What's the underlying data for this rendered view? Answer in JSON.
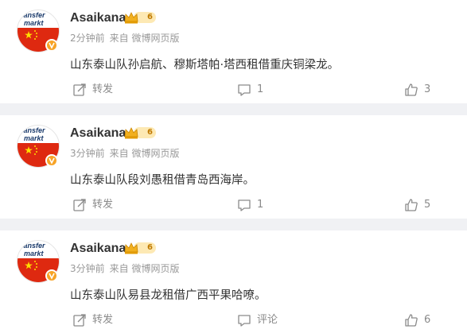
{
  "avatar": {
    "logo_line1": "ransfer",
    "logo_line2": "markt"
  },
  "posts": [
    {
      "user": "Asaikana",
      "rank": "6",
      "time": "2分钟前",
      "source": "来自 微博网页版",
      "text": "山东泰山队孙启航、穆斯塔帕·塔西租借重庆铜梁龙。",
      "share": "转发",
      "comment": "1",
      "like": "3"
    },
    {
      "user": "Asaikana",
      "rank": "6",
      "time": "3分钟前",
      "source": "来自 微博网页版",
      "text": "山东泰山队段刘愚租借青岛西海岸。",
      "share": "转发",
      "comment": "1",
      "like": "5"
    },
    {
      "user": "Asaikana",
      "rank": "6",
      "time": "3分钟前",
      "source": "来自 微博网页版",
      "text": "山东泰山队易县龙租借广西平果哈嘹。",
      "share": "转发",
      "comment": "评论",
      "like": "6"
    }
  ],
  "colors": {
    "vip": "#f7a326",
    "flag": "#de2910",
    "star": "#ffde00"
  }
}
